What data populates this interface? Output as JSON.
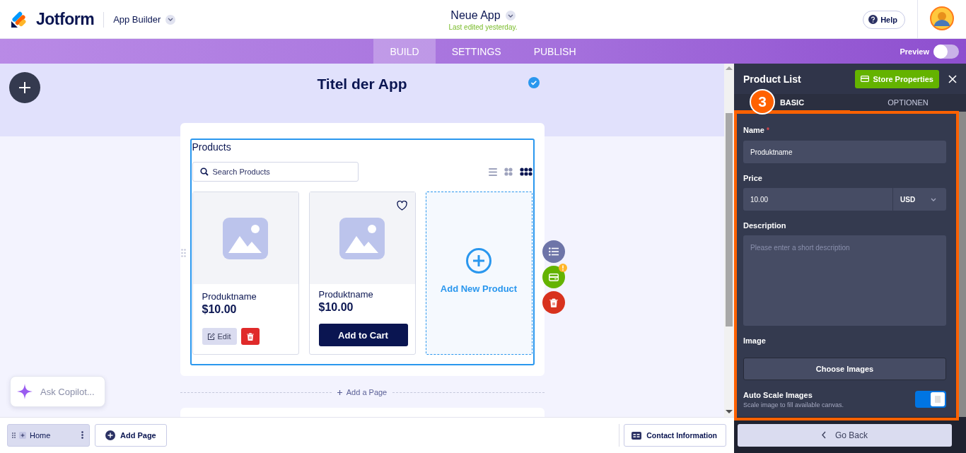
{
  "header": {
    "logo": "Jotform",
    "product": "App Builder",
    "app_name": "Neue App",
    "last_edited": "Last edited yesterday.",
    "help": "Help"
  },
  "nav": {
    "tabs": [
      {
        "label": "BUILD",
        "selected": true
      },
      {
        "label": "SETTINGS",
        "selected": false
      },
      {
        "label": "PUBLISH",
        "selected": false
      }
    ],
    "preview": {
      "label": "Preview",
      "on": false
    }
  },
  "canvas": {
    "app_title": "Titel der App",
    "widget": {
      "title": "Products",
      "search": {
        "placeholder": "Search Products"
      },
      "views": [
        {
          "kind": "list",
          "selected": false
        },
        {
          "kind": "grid",
          "selected": false
        },
        {
          "kind": "compact",
          "selected": true
        }
      ],
      "products": [
        {
          "kind": "editable",
          "name": "Produktname",
          "price": "$10.00",
          "action": "Edit"
        },
        {
          "kind": "shop",
          "name": "Produktname",
          "price": "$10.00",
          "action": "Add to Cart"
        }
      ],
      "add_product": "Add New Product"
    },
    "add_page": "Add a Page",
    "copilot": {
      "placeholder": "Ask Copilot..."
    }
  },
  "bottom_bar": {
    "pages": [
      {
        "label": "Home",
        "selected": true
      }
    ],
    "add_page": "Add Page",
    "contact": "Contact Information"
  },
  "panel": {
    "title": "Product List",
    "store_button": "Store Properties",
    "annotation": "3",
    "tabs": [
      {
        "label": "BASIC",
        "selected": true
      },
      {
        "label": "OPTIONEN",
        "selected": false
      }
    ],
    "fields": [
      {
        "kind": "text",
        "label": "Name",
        "required_mark": "*",
        "value": "Produktname"
      },
      {
        "kind": "price",
        "label": "Price",
        "value": "10.00",
        "currency": "USD"
      },
      {
        "kind": "textarea",
        "label": "Description",
        "placeholder": "Please enter a short description"
      },
      {
        "kind": "upload",
        "label": "Image",
        "button": "Choose Images"
      },
      {
        "kind": "toggle",
        "label": "Auto Scale Images",
        "hint": "Scale image to fill available canvas.",
        "on": true
      }
    ],
    "go_back": "Go Back"
  }
}
